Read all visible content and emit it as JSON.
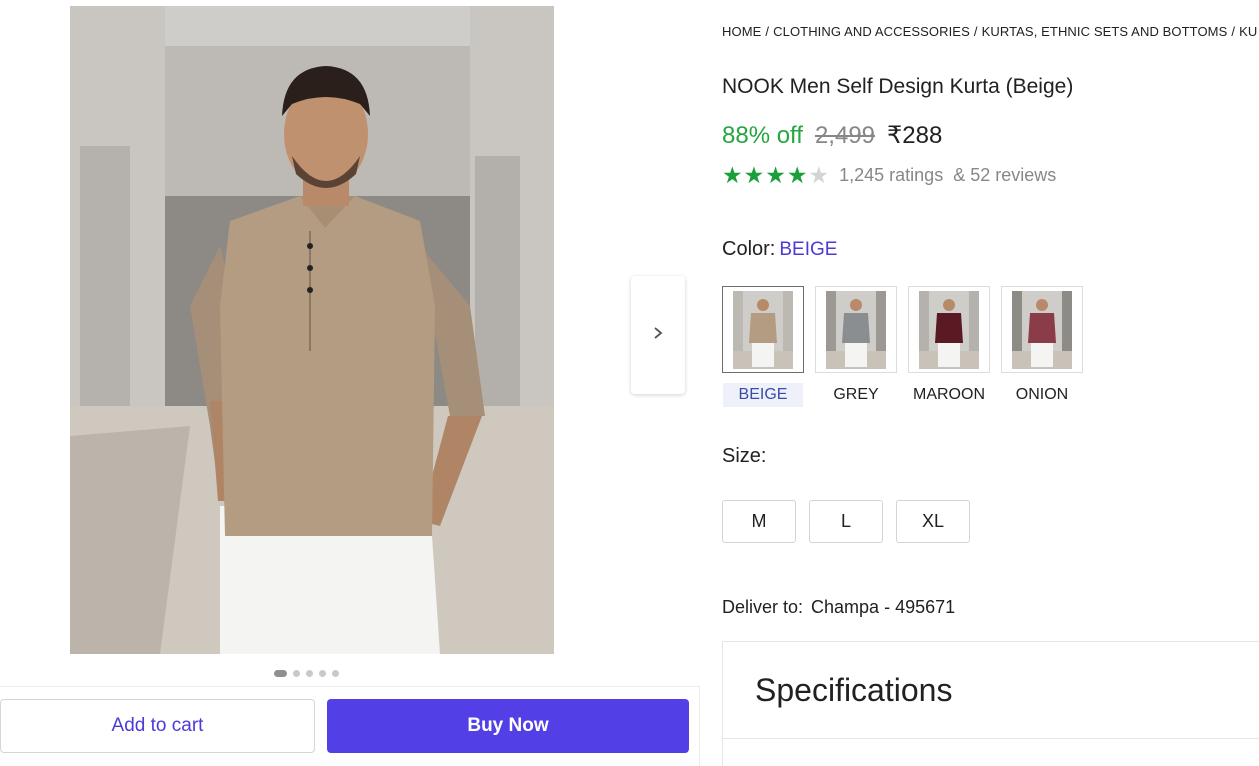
{
  "breadcrumb": {
    "items": [
      "HOME",
      "CLOTHING AND ACCESSORIES",
      "KURTAS, ETHNIC SETS AND BOTTOMS",
      "KU"
    ]
  },
  "product": {
    "title": "NOOK Men Self Design Kurta (Beige)",
    "discount": "88% off",
    "mrp": "2,499",
    "price": "₹288",
    "rating_stars": 4,
    "ratings_text": "1,245 ratings",
    "reviews_text": "& 52 reviews"
  },
  "color": {
    "label": "Color:",
    "selected": "BEIGE",
    "options": [
      {
        "name": "BEIGE",
        "shirt": "#b39c82"
      },
      {
        "name": "GREY",
        "shirt": "#8b8e90"
      },
      {
        "name": "MAROON",
        "shirt": "#5a1a24"
      },
      {
        "name": "ONION",
        "shirt": "#8a3c48"
      }
    ]
  },
  "size": {
    "label": "Size:",
    "options": [
      "M",
      "L",
      "XL"
    ]
  },
  "delivery": {
    "label": "Deliver to:",
    "location": "Champa - 495671"
  },
  "specifications": {
    "title": "Specifications"
  },
  "gallery": {
    "image_count": 5,
    "active_index": 0
  },
  "actions": {
    "add_to_cart": "Add to cart",
    "buy_now": "Buy Now"
  },
  "colors": {
    "accent": "#5240e6",
    "discount_green": "#26a541",
    "star_green": "#1a9f3a"
  },
  "icons": {
    "next": "chevron-right-icon",
    "star": "star-icon"
  }
}
